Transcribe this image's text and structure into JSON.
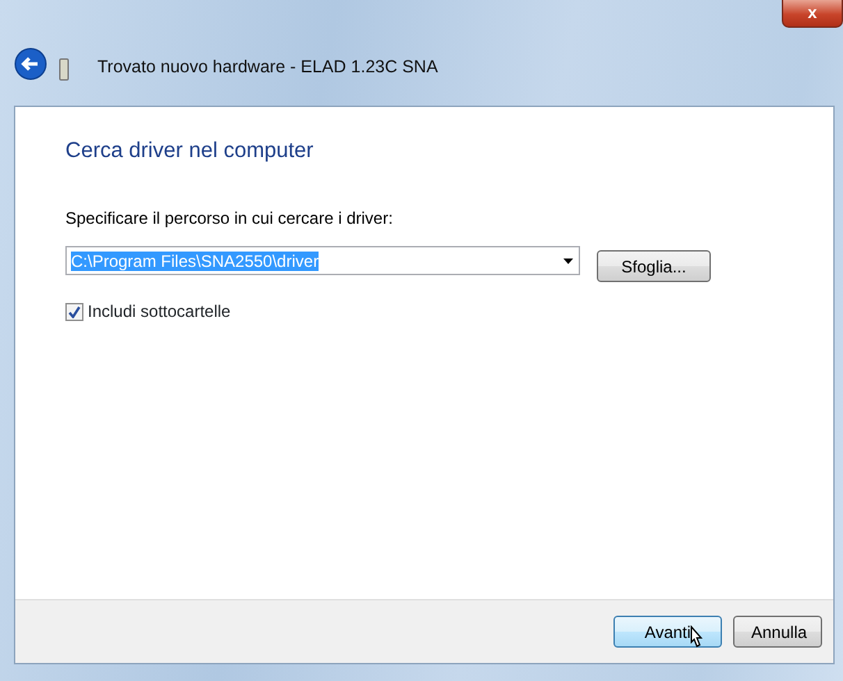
{
  "window": {
    "title": "Trovato nuovo hardware - ELAD 1.23C SNA",
    "close_label": "x"
  },
  "heading": "Cerca driver nel computer",
  "path_field": {
    "label": "Specificare il percorso in cui cercare i driver:",
    "value": "C:\\Program Files\\SNA2550\\driver",
    "selected": true
  },
  "browse_button": "Sfoglia...",
  "include_subfolders": {
    "label": "Includi sottocartelle",
    "checked": true
  },
  "buttons": [
    {
      "label": "Avanti",
      "default": true
    },
    {
      "label": "Annulla",
      "default": false
    }
  ]
}
